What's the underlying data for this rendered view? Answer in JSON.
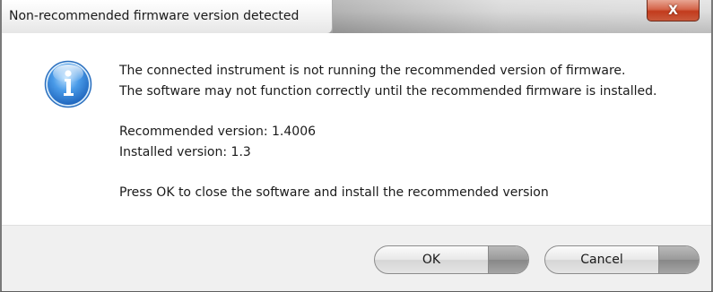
{
  "window": {
    "title": "Non-recommended firmware version detected",
    "close_glyph": "X"
  },
  "message": {
    "icon": "info-icon",
    "line1": "The connected instrument is not running the recommended version of firmware.",
    "line2": "The software may not function correctly until the recommended firmware is installed.",
    "recommended": "Recommended version: 1.4006",
    "installed": "Installed version: 1.3",
    "instruction": "Press OK to close the software and install the recommended version"
  },
  "buttons": {
    "ok_label": "OK",
    "cancel_label": "Cancel"
  },
  "colors": {
    "close_button": "#c23b1d",
    "icon_blue": "#2f7fd6",
    "footer_bg": "#f0f0f0"
  }
}
